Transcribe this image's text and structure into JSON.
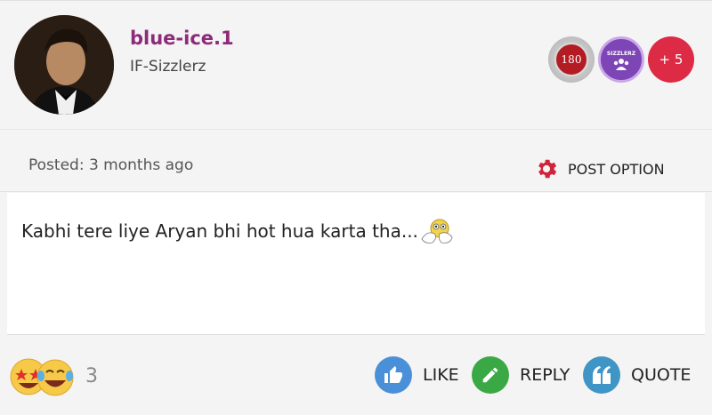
{
  "user": {
    "username": "blue-ice.1",
    "title": "IF-Sizzlerz"
  },
  "badges": {
    "level": "180",
    "group_label": "SIZZLERZ",
    "more": "+ 5"
  },
  "meta": {
    "posted": "Posted: 3 months ago",
    "post_option": "POST OPTION"
  },
  "post": {
    "text": "Kabhi tere liye Aryan bhi hot hua karta tha..."
  },
  "footer": {
    "reaction_count": "3",
    "like_label": "LIKE",
    "reply_label": "REPLY",
    "quote_label": "QUOTE"
  },
  "colors": {
    "username": "#8e2a7a",
    "gear": "#d0243c",
    "like": "#4a90d9",
    "reply": "#3aa845",
    "quote": "#3f95c6",
    "more_badge": "#dd2a45"
  },
  "icons": {
    "gear": "gear-icon",
    "like": "thumbs-up-icon",
    "reply": "pencil-icon",
    "quote": "quote-icon"
  }
}
